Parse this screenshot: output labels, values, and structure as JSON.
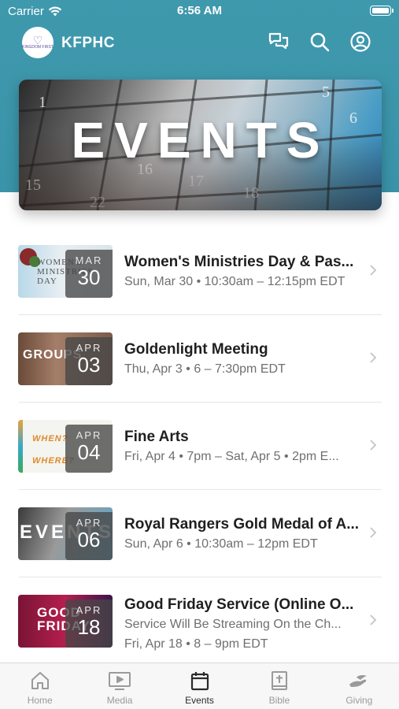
{
  "status_bar": {
    "carrier": "Carrier",
    "time": "6:56 AM"
  },
  "app": {
    "title": "KFPHC",
    "logo_text": "KINGDOM FIRST"
  },
  "hero": {
    "title": "EVENTS"
  },
  "events": [
    {
      "title": "Women's Ministries Day & Pas...",
      "subtitle": "Sun, Mar 30 • 10:30am – 12:15pm EDT",
      "subtitle2": "",
      "month": "MAR",
      "day": "30",
      "thumb_text": "WOMEN'S MINISTRIES DAY"
    },
    {
      "title": "Goldenlight Meeting",
      "subtitle": "Thu, Apr 3 • 6 – 7:30pm EDT",
      "subtitle2": "",
      "month": "APR",
      "day": "03",
      "thumb_text": "GROUPS"
    },
    {
      "title": "Fine Arts",
      "subtitle": "Fri, Apr 4 • 7pm – Sat, Apr 5 • 2pm E...",
      "subtitle2": "",
      "month": "APR",
      "day": "04",
      "thumb_text": "WHEN? WHERE?"
    },
    {
      "title": "Royal Rangers Gold Medal of A...",
      "subtitle": "Sun, Apr 6 • 10:30am – 12pm EDT",
      "subtitle2": "",
      "month": "APR",
      "day": "06",
      "thumb_text": "EVENTS"
    },
    {
      "title": "Good Friday Service (Online O...",
      "subtitle": "Service Will Be Streaming On the Ch...",
      "subtitle2": "Fri, Apr 18 • 8 – 9pm EDT",
      "month": "APR",
      "day": "18",
      "thumb_text": "GOOD FRIDAY"
    }
  ],
  "tabs": [
    {
      "label": "Home",
      "icon": "home-icon"
    },
    {
      "label": "Media",
      "icon": "media-icon"
    },
    {
      "label": "Events",
      "icon": "calendar-icon"
    },
    {
      "label": "Bible",
      "icon": "bible-icon"
    },
    {
      "label": "Giving",
      "icon": "giving-icon"
    }
  ],
  "colors": {
    "header_teal": "#3f99ad",
    "active_tab": "#2a2a2a",
    "inactive_tab": "#9a9a9a"
  }
}
